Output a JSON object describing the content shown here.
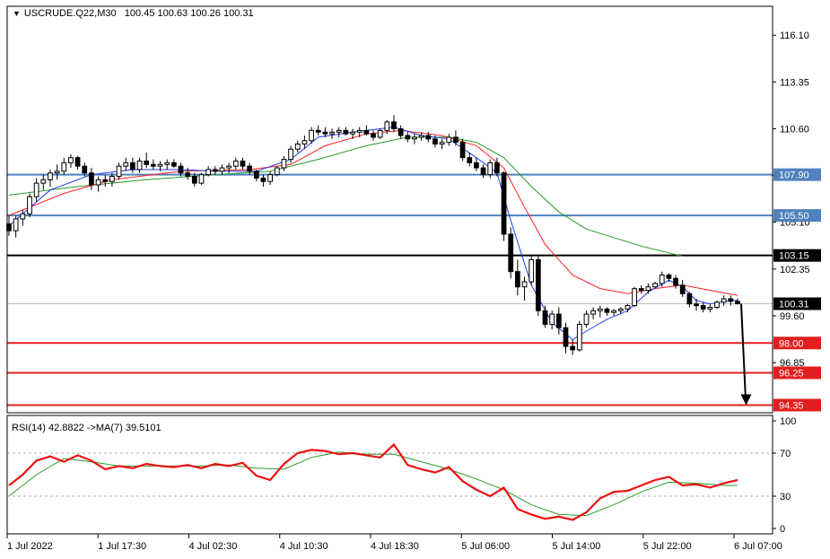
{
  "header": {
    "symbol": "USCRUDE.Q22,M30",
    "open": "100.45",
    "high": "100.63",
    "low": "100.26",
    "close": "100.31"
  },
  "rsi_header": "RSI(14) 42.8822  ->MA(7) 39.5101",
  "colors": {
    "bull_candle": "#ffffff",
    "bear_candle": "#000000",
    "ma_fast": "#1f3ff0",
    "ma_mid": "#ff2020",
    "ma_slow": "#2a9a2a",
    "line_blue": "#4f81bd",
    "line_red": "#e02020",
    "line_black": "#000000",
    "rsi": "#ee1111",
    "rsi_ma": "#2a9a2a"
  },
  "chart_data": {
    "type": "candlestick",
    "symbol": "USCRUDE.Q22",
    "timeframe": "M30",
    "price_axis": {
      "ticks": [
        "116.10",
        "113.35",
        "110.60",
        "107.85",
        "105.10",
        "102.35",
        "99.60",
        "96.85"
      ],
      "ylim": [
        93.9,
        117.8
      ]
    },
    "x_axis_labels": [
      "1 Jul 2022",
      "1 Jul 17:30",
      "4 Jul 02:30",
      "4 Jul 10:30",
      "4 Jul 18:30",
      "5 Jul 06:00",
      "5 Jul 14:00",
      "5 Jul 22:00",
      "6 Jul 07:00"
    ],
    "horizontal_lines": [
      {
        "value": 107.9,
        "label": "107.90",
        "color": "#4f81bd"
      },
      {
        "value": 105.5,
        "label": "105.50",
        "color": "#4f81bd"
      },
      {
        "value": 103.15,
        "label": "103.15",
        "color": "#000000"
      },
      {
        "value": 98.0,
        "label": "98.00",
        "color": "#e02020"
      },
      {
        "value": 96.25,
        "label": "96.25",
        "color": "#e02020"
      },
      {
        "value": 94.35,
        "label": "94.35",
        "color": "#e02020"
      }
    ],
    "current_price": {
      "value": 100.31,
      "label": "100.31"
    },
    "ohlc": [
      [
        105.0,
        105.5,
        104.3,
        104.6
      ],
      [
        104.6,
        105.5,
        104.2,
        105.3
      ],
      [
        105.3,
        105.8,
        104.9,
        105.6
      ],
      [
        105.6,
        106.8,
        105.4,
        106.6
      ],
      [
        106.6,
        107.7,
        106.3,
        107.4
      ],
      [
        107.4,
        107.9,
        107.0,
        107.6
      ],
      [
        107.6,
        108.2,
        107.2,
        108.0
      ],
      [
        108.0,
        108.5,
        107.6,
        108.1
      ],
      [
        108.1,
        108.9,
        107.9,
        108.6
      ],
      [
        108.6,
        109.1,
        108.3,
        108.9
      ],
      [
        108.9,
        109.0,
        108.2,
        108.4
      ],
      [
        108.4,
        108.6,
        107.8,
        108.0
      ],
      [
        108.0,
        108.3,
        107.0,
        107.3
      ],
      [
        107.3,
        107.8,
        106.9,
        107.6
      ],
      [
        107.6,
        107.9,
        107.2,
        107.5
      ],
      [
        107.5,
        108.0,
        107.2,
        107.8
      ],
      [
        107.8,
        108.6,
        107.6,
        108.4
      ],
      [
        108.4,
        108.9,
        108.1,
        108.6
      ],
      [
        108.6,
        108.9,
        108.0,
        108.2
      ],
      [
        108.2,
        108.9,
        108.0,
        108.7
      ],
      [
        108.7,
        109.2,
        108.3,
        108.5
      ],
      [
        108.5,
        108.8,
        108.2,
        108.4
      ],
      [
        108.4,
        108.7,
        108.1,
        108.5
      ],
      [
        108.5,
        108.8,
        108.2,
        108.6
      ],
      [
        108.6,
        108.8,
        108.3,
        108.4
      ],
      [
        108.4,
        108.6,
        107.8,
        108.0
      ],
      [
        108.0,
        108.3,
        107.6,
        107.8
      ],
      [
        107.8,
        108.0,
        107.2,
        107.4
      ],
      [
        107.4,
        108.0,
        107.3,
        107.9
      ],
      [
        107.9,
        108.4,
        107.8,
        108.2
      ],
      [
        108.2,
        108.4,
        107.9,
        108.1
      ],
      [
        108.1,
        108.5,
        107.9,
        108.3
      ],
      [
        108.3,
        108.6,
        108.0,
        108.4
      ],
      [
        108.4,
        108.9,
        108.2,
        108.7
      ],
      [
        108.7,
        108.9,
        108.2,
        108.4
      ],
      [
        108.4,
        108.6,
        107.9,
        108.1
      ],
      [
        108.1,
        108.2,
        107.5,
        107.7
      ],
      [
        107.7,
        107.9,
        107.2,
        107.5
      ],
      [
        107.5,
        108.1,
        107.3,
        107.9
      ],
      [
        107.9,
        108.4,
        107.8,
        108.3
      ],
      [
        108.3,
        109.0,
        108.1,
        108.8
      ],
      [
        108.8,
        109.6,
        108.6,
        109.4
      ],
      [
        109.4,
        109.9,
        109.2,
        109.7
      ],
      [
        109.7,
        110.2,
        109.4,
        109.9
      ],
      [
        109.9,
        110.7,
        109.7,
        110.5
      ],
      [
        110.5,
        110.8,
        110.2,
        110.4
      ],
      [
        110.4,
        110.7,
        110.1,
        110.3
      ],
      [
        110.3,
        110.6,
        110.0,
        110.4
      ],
      [
        110.4,
        110.7,
        110.1,
        110.5
      ],
      [
        110.5,
        110.7,
        110.2,
        110.3
      ],
      [
        110.3,
        110.6,
        110.0,
        110.4
      ],
      [
        110.4,
        110.7,
        110.1,
        110.5
      ],
      [
        110.5,
        110.8,
        110.2,
        110.3
      ],
      [
        110.3,
        110.5,
        109.9,
        110.1
      ],
      [
        110.1,
        110.6,
        110.0,
        110.5
      ],
      [
        110.5,
        111.1,
        110.3,
        111.0
      ],
      [
        111.0,
        111.4,
        110.4,
        110.6
      ],
      [
        110.6,
        110.8,
        110.0,
        110.2
      ],
      [
        110.2,
        110.4,
        109.8,
        110.0
      ],
      [
        110.0,
        110.3,
        109.7,
        110.1
      ],
      [
        110.1,
        110.4,
        109.9,
        110.2
      ],
      [
        110.2,
        110.4,
        109.8,
        110.0
      ],
      [
        110.0,
        110.2,
        109.5,
        109.7
      ],
      [
        109.7,
        110.0,
        109.4,
        109.8
      ],
      [
        109.8,
        110.3,
        109.6,
        110.1
      ],
      [
        110.1,
        110.5,
        109.6,
        109.8
      ],
      [
        109.8,
        110.0,
        108.7,
        108.9
      ],
      [
        108.9,
        109.2,
        108.4,
        108.6
      ],
      [
        108.6,
        108.9,
        108.1,
        108.3
      ],
      [
        108.3,
        108.5,
        107.7,
        107.9
      ],
      [
        107.9,
        108.8,
        107.7,
        108.6
      ],
      [
        108.6,
        108.9,
        107.8,
        108.0
      ],
      [
        108.0,
        108.1,
        104.0,
        104.4
      ],
      [
        104.4,
        104.8,
        101.8,
        102.2
      ],
      [
        102.2,
        102.9,
        100.8,
        101.3
      ],
      [
        101.3,
        101.9,
        100.5,
        101.6
      ],
      [
        101.6,
        103.1,
        101.4,
        102.9
      ],
      [
        102.9,
        103.1,
        99.6,
        99.9
      ],
      [
        99.9,
        100.2,
        98.9,
        99.1
      ],
      [
        99.1,
        99.9,
        98.8,
        99.7
      ],
      [
        99.7,
        100.1,
        98.5,
        98.9
      ],
      [
        98.9,
        99.2,
        97.4,
        97.8
      ],
      [
        97.8,
        98.2,
        97.3,
        97.6
      ],
      [
        97.6,
        99.3,
        97.5,
        99.1
      ],
      [
        99.1,
        99.9,
        98.9,
        99.7
      ],
      [
        99.7,
        100.1,
        99.4,
        99.9
      ],
      [
        99.9,
        100.2,
        99.5,
        100.0
      ],
      [
        100.0,
        100.1,
        99.6,
        99.8
      ],
      [
        99.8,
        100.0,
        99.6,
        99.9
      ],
      [
        99.9,
        100.1,
        99.7,
        100.0
      ],
      [
        100.0,
        100.3,
        99.8,
        100.2
      ],
      [
        100.2,
        101.3,
        100.1,
        101.2
      ],
      [
        101.2,
        101.4,
        100.9,
        101.1
      ],
      [
        101.1,
        101.5,
        100.9,
        101.3
      ],
      [
        101.3,
        101.6,
        101.2,
        101.5
      ],
      [
        101.5,
        102.2,
        101.3,
        102.0
      ],
      [
        102.0,
        102.1,
        101.6,
        101.8
      ],
      [
        101.8,
        102.0,
        101.2,
        101.4
      ],
      [
        101.4,
        101.7,
        100.7,
        100.9
      ],
      [
        100.9,
        101.0,
        100.1,
        100.3
      ],
      [
        100.3,
        100.6,
        99.9,
        100.2
      ],
      [
        100.2,
        100.4,
        99.8,
        100.0
      ],
      [
        100.0,
        100.3,
        99.8,
        100.1
      ],
      [
        100.1,
        100.5,
        100.0,
        100.4
      ],
      [
        100.4,
        100.8,
        100.2,
        100.6
      ],
      [
        100.6,
        100.8,
        100.2,
        100.45
      ],
      [
        100.45,
        100.63,
        100.26,
        100.31
      ]
    ],
    "ma_fast": [
      [
        0,
        104.9
      ],
      [
        6,
        107.0
      ],
      [
        12,
        107.9
      ],
      [
        18,
        108.2
      ],
      [
        25,
        108.2
      ],
      [
        30,
        108.1
      ],
      [
        36,
        108.1
      ],
      [
        41,
        108.8
      ],
      [
        45,
        110.1
      ],
      [
        50,
        110.4
      ],
      [
        56,
        110.7
      ],
      [
        60,
        110.2
      ],
      [
        64,
        110.0
      ],
      [
        68,
        108.9
      ],
      [
        71,
        108.0
      ],
      [
        73,
        105.2
      ],
      [
        76,
        101.4
      ],
      [
        79,
        99.2
      ],
      [
        82,
        98.2
      ],
      [
        84,
        98.7
      ],
      [
        87,
        99.4
      ],
      [
        90,
        99.9
      ],
      [
        93,
        101.0
      ],
      [
        96,
        101.7
      ],
      [
        98,
        101.3
      ],
      [
        100,
        100.5
      ],
      [
        102,
        100.3
      ],
      [
        105,
        100.5
      ],
      [
        106,
        100.5
      ]
    ],
    "ma_mid": [
      [
        0,
        105.5
      ],
      [
        8,
        106.8
      ],
      [
        15,
        107.6
      ],
      [
        25,
        108.1
      ],
      [
        35,
        108.2
      ],
      [
        41,
        108.5
      ],
      [
        46,
        109.6
      ],
      [
        52,
        110.3
      ],
      [
        57,
        110.5
      ],
      [
        63,
        110.2
      ],
      [
        68,
        109.6
      ],
      [
        72,
        108.3
      ],
      [
        75,
        106.0
      ],
      [
        78,
        103.8
      ],
      [
        82,
        102.0
      ],
      [
        86,
        101.2
      ],
      [
        90,
        100.9
      ],
      [
        94,
        101.2
      ],
      [
        98,
        101.4
      ],
      [
        102,
        101.1
      ],
      [
        106,
        100.8
      ]
    ],
    "ma_slow": [
      [
        0,
        106.7
      ],
      [
        10,
        107.2
      ],
      [
        20,
        107.6
      ],
      [
        30,
        107.9
      ],
      [
        38,
        108.1
      ],
      [
        45,
        108.8
      ],
      [
        52,
        109.6
      ],
      [
        58,
        110.1
      ],
      [
        64,
        110.1
      ],
      [
        68,
        109.8
      ],
      [
        72,
        108.9
      ],
      [
        76,
        107.2
      ],
      [
        80,
        105.7
      ],
      [
        84,
        104.7
      ],
      [
        88,
        104.2
      ],
      [
        92,
        103.7
      ],
      [
        96,
        103.3
      ],
      [
        98,
        103.1
      ]
    ],
    "arrow": {
      "from_index": 106,
      "from_price": 100.31,
      "to_price": 94.35
    },
    "rsi": {
      "label": "RSI(14)",
      "value": 42.8822,
      "ma_label": "MA(7)",
      "ma_value": 39.5101,
      "levels": [
        70,
        30
      ],
      "ticks": [
        "100",
        "70",
        "30",
        "0"
      ],
      "ylim": [
        -5,
        105
      ],
      "values": [
        [
          0,
          40
        ],
        [
          2,
          50
        ],
        [
          4,
          63
        ],
        [
          6,
          67
        ],
        [
          8,
          62
        ],
        [
          10,
          68
        ],
        [
          12,
          63
        ],
        [
          14,
          55
        ],
        [
          16,
          58
        ],
        [
          18,
          56
        ],
        [
          20,
          60
        ],
        [
          22,
          58
        ],
        [
          24,
          57
        ],
        [
          26,
          59
        ],
        [
          28,
          56
        ],
        [
          30,
          60
        ],
        [
          32,
          58
        ],
        [
          34,
          61
        ],
        [
          36,
          49
        ],
        [
          38,
          45
        ],
        [
          40,
          60
        ],
        [
          42,
          70
        ],
        [
          44,
          73
        ],
        [
          46,
          72
        ],
        [
          48,
          69
        ],
        [
          50,
          70
        ],
        [
          52,
          68
        ],
        [
          54,
          66
        ],
        [
          56,
          78
        ],
        [
          58,
          59
        ],
        [
          60,
          55
        ],
        [
          62,
          52
        ],
        [
          64,
          57
        ],
        [
          66,
          44
        ],
        [
          68,
          36
        ],
        [
          70,
          30
        ],
        [
          72,
          38
        ],
        [
          74,
          18
        ],
        [
          76,
          13
        ],
        [
          78,
          9
        ],
        [
          80,
          11
        ],
        [
          82,
          8
        ],
        [
          84,
          15
        ],
        [
          86,
          28
        ],
        [
          88,
          34
        ],
        [
          90,
          35
        ],
        [
          92,
          40
        ],
        [
          94,
          45
        ],
        [
          96,
          48
        ],
        [
          98,
          40
        ],
        [
          100,
          41
        ],
        [
          102,
          38
        ],
        [
          104,
          42
        ],
        [
          106,
          45
        ]
      ],
      "ma_values": [
        [
          0,
          30
        ],
        [
          4,
          50
        ],
        [
          8,
          65
        ],
        [
          12,
          62
        ],
        [
          16,
          58
        ],
        [
          20,
          58
        ],
        [
          24,
          58
        ],
        [
          28,
          58
        ],
        [
          32,
          59
        ],
        [
          36,
          56
        ],
        [
          40,
          55
        ],
        [
          44,
          66
        ],
        [
          48,
          71
        ],
        [
          52,
          69
        ],
        [
          56,
          69
        ],
        [
          60,
          62
        ],
        [
          64,
          55
        ],
        [
          68,
          46
        ],
        [
          72,
          36
        ],
        [
          76,
          22
        ],
        [
          80,
          13
        ],
        [
          84,
          12
        ],
        [
          88,
          22
        ],
        [
          92,
          34
        ],
        [
          96,
          43
        ],
        [
          100,
          42
        ],
        [
          104,
          40
        ],
        [
          106,
          40
        ]
      ]
    }
  }
}
